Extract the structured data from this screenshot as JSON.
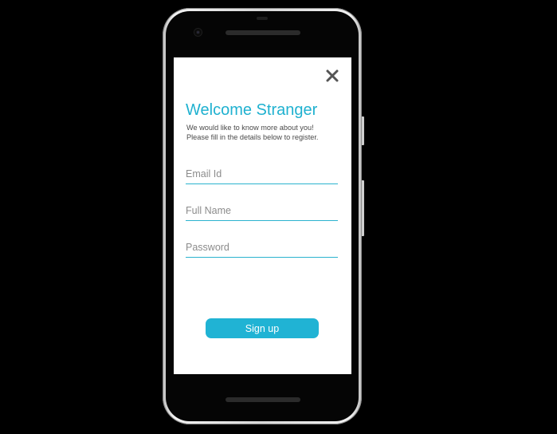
{
  "dialog": {
    "title": "Welcome Stranger",
    "subtitle_line1": "We would like to know more about you!",
    "subtitle_line2": "Please fill in the details below to register.",
    "close_icon": "close-icon"
  },
  "form": {
    "email": {
      "placeholder": "Email Id",
      "value": ""
    },
    "full_name": {
      "placeholder": "Full Name",
      "value": ""
    },
    "password": {
      "placeholder": "Password",
      "value": ""
    }
  },
  "actions": {
    "signup_label": "Sign up"
  },
  "colors": {
    "accent": "#1fb1d0",
    "button": "#20b3d4",
    "background": "#000000",
    "screen": "#ffffff"
  }
}
